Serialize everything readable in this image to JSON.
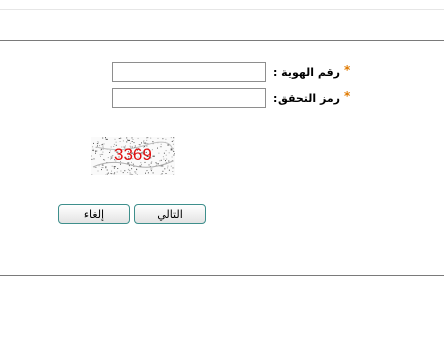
{
  "form": {
    "id_field": {
      "label": "رقم الهوية",
      "required_mark": "*",
      "colon": ":",
      "value": ""
    },
    "code_field": {
      "label": "رمز التحقق",
      "required_mark": "*",
      "colon": ":",
      "value": ""
    },
    "captcha": {
      "text": "3369",
      "text_color": "#e01010"
    },
    "buttons": {
      "next_label": "التالي",
      "cancel_label": "إلغاء"
    }
  },
  "colors": {
    "required_mark": "#e07a00",
    "button_border": "#3e8f8c",
    "rule": "#7a7a7a"
  }
}
